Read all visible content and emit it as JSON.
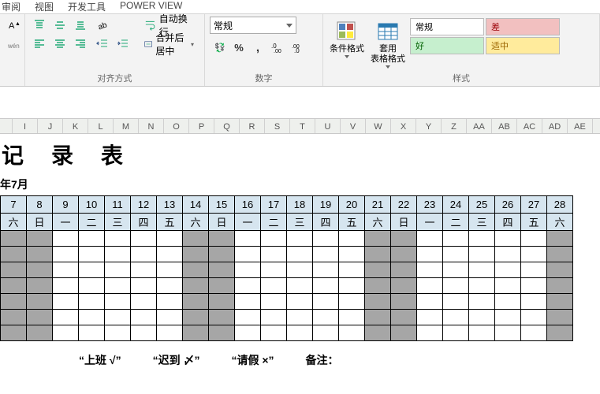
{
  "menu": {
    "review": "审阅",
    "view": "视图",
    "dev": "开发工具",
    "power": "POWER VIEW"
  },
  "ribbon": {
    "align_group": "对齐方式",
    "number_group": "数字",
    "style_group": "样式",
    "wrap": "自动换行",
    "merge": "合并后居中",
    "num_format": "常规",
    "cond_fmt": "条件格式",
    "tbl_fmt": "套用\n表格格式",
    "sw_normal": "常规",
    "sw_bad": "差",
    "sw_good": "好",
    "sw_mid": "适中"
  },
  "cols": [
    "",
    "I",
    "J",
    "K",
    "L",
    "M",
    "N",
    "O",
    "P",
    "Q",
    "R",
    "S",
    "T",
    "U",
    "V",
    "W",
    "X",
    "Y",
    "Z",
    "AA",
    "AB",
    "AC",
    "AD",
    "AE"
  ],
  "sheet": {
    "title": "记 录 表",
    "month": "年7月",
    "days": [
      "7",
      "8",
      "9",
      "10",
      "11",
      "12",
      "13",
      "14",
      "15",
      "16",
      "17",
      "18",
      "19",
      "20",
      "21",
      "22",
      "23",
      "24",
      "25",
      "26",
      "27",
      "28"
    ],
    "wdays": [
      "六",
      "日",
      "一",
      "二",
      "三",
      "四",
      "五",
      "六",
      "日",
      "一",
      "二",
      "三",
      "四",
      "五",
      "六",
      "日",
      "一",
      "二",
      "三",
      "四",
      "五",
      "六"
    ],
    "weekend_idx": [
      0,
      1,
      7,
      8,
      14,
      15,
      21
    ],
    "legend1": "“上班 √”",
    "legend2": "“迟到 〆”",
    "legend3": "“请假 ×”",
    "legend4": "备注："
  }
}
